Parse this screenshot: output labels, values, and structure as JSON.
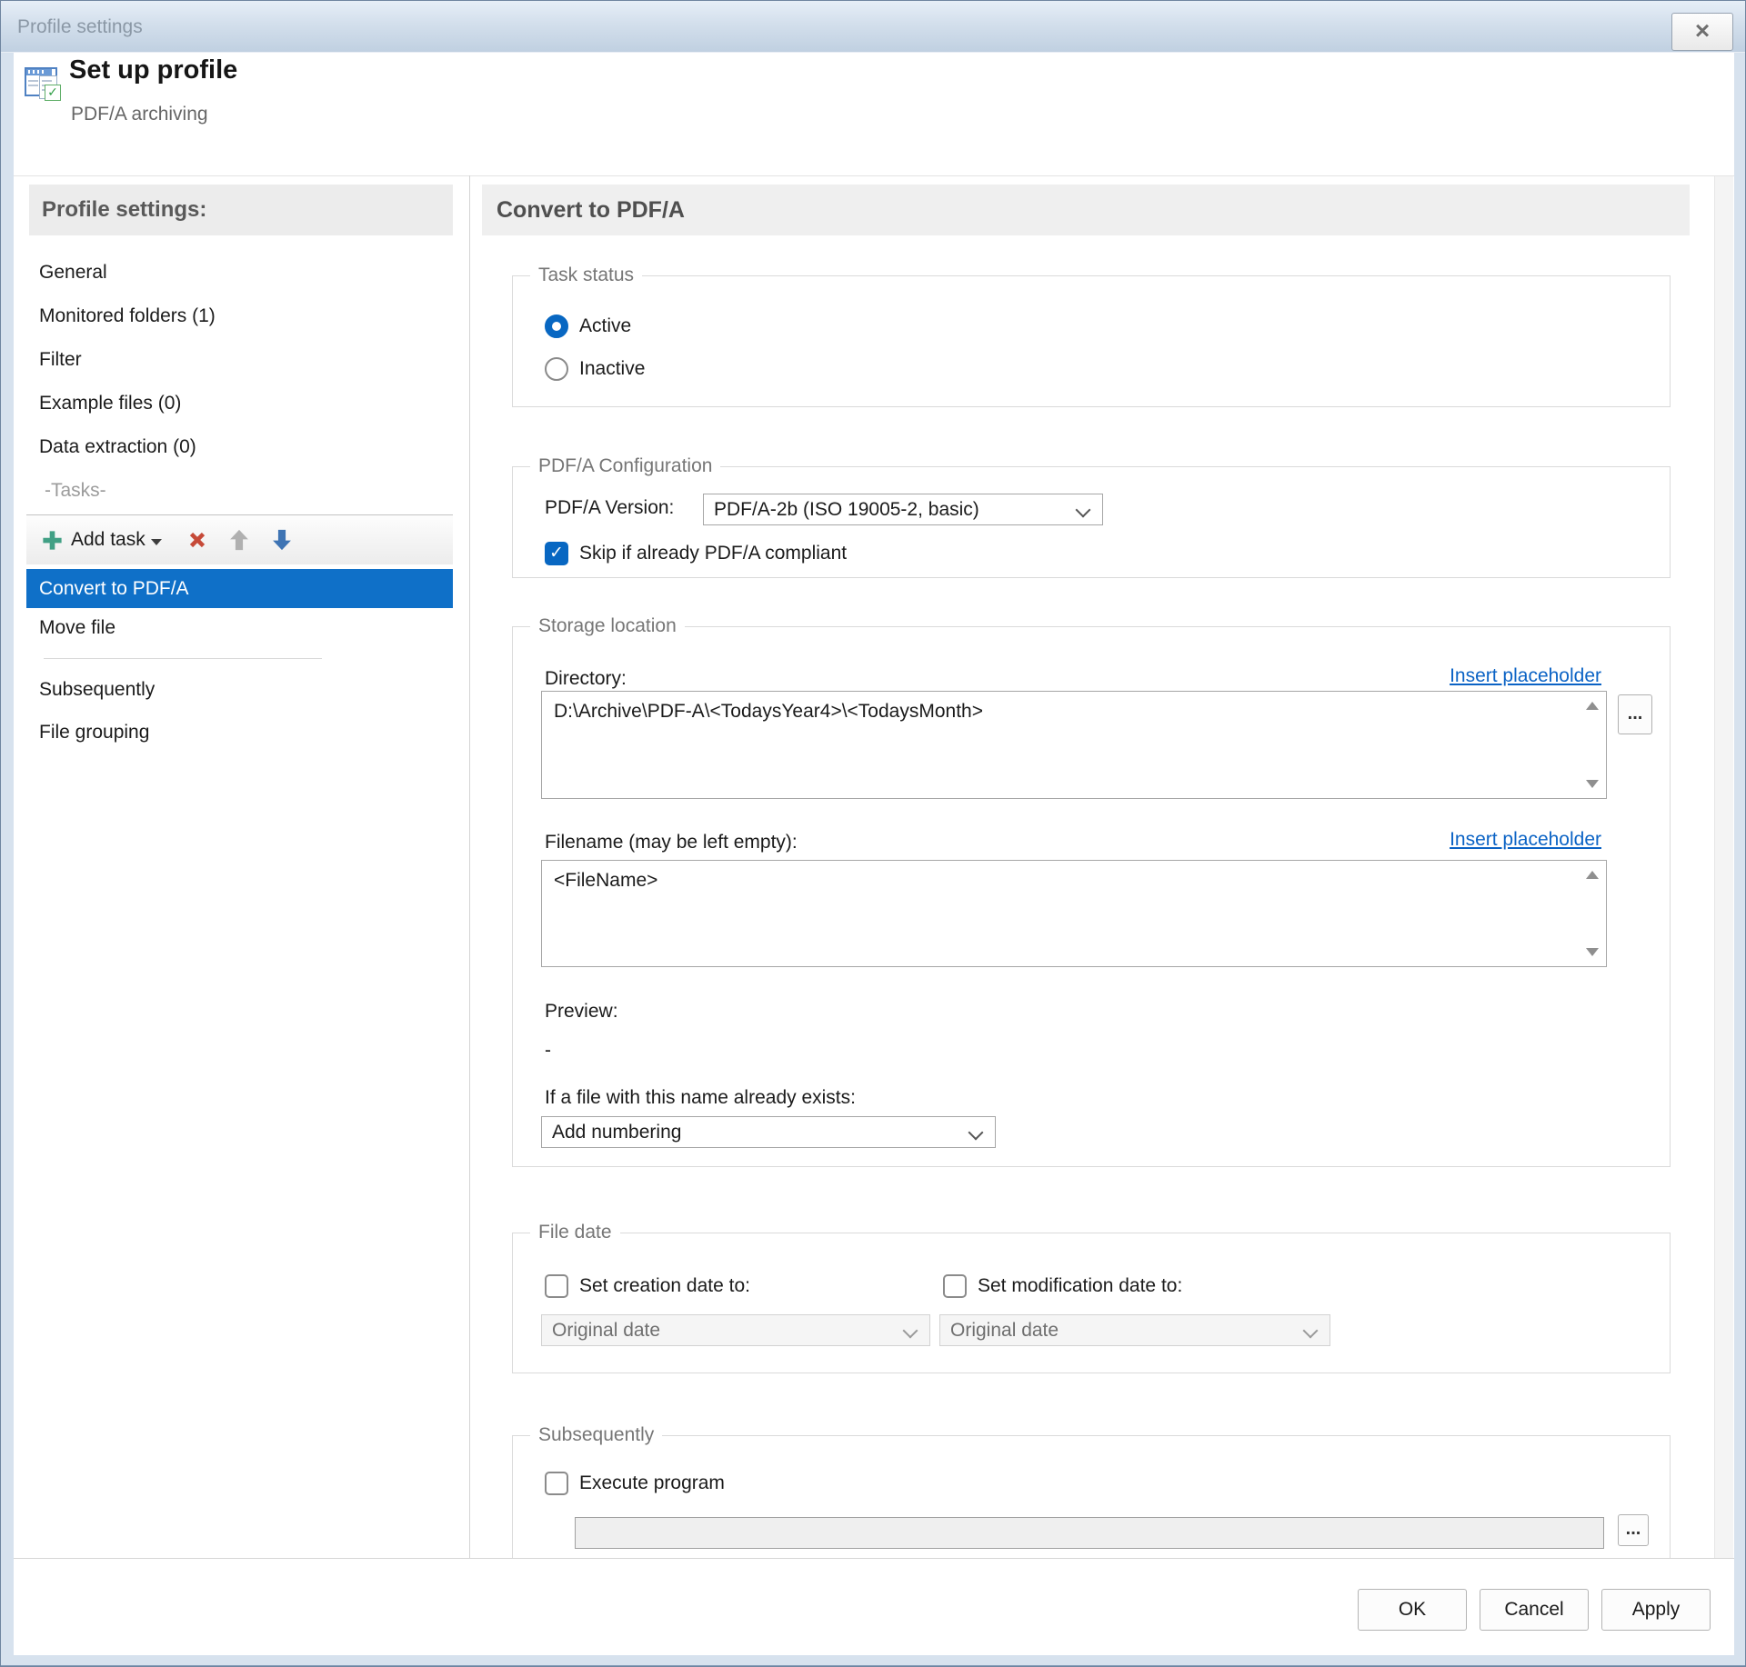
{
  "window": {
    "title": "Profile settings",
    "close_glyph": "×"
  },
  "header": {
    "title": "Set up profile",
    "subtitle": "PDF/A archiving"
  },
  "sidebar": {
    "heading": "Profile settings:",
    "items": [
      "General",
      "Monitored folders (1)",
      "Filter",
      "Example files (0)",
      "Data extraction (0)"
    ],
    "tasks_label": "-Tasks-",
    "toolbar": {
      "add_task_label": "Add task"
    },
    "tasks": [
      {
        "label": "Convert to PDF/A",
        "selected": true
      },
      {
        "label": "Move file",
        "selected": false
      }
    ],
    "bottom_items": [
      "Subsequently",
      "File grouping"
    ]
  },
  "main": {
    "title": "Convert to PDF/A",
    "task_status": {
      "legend": "Task status",
      "options": [
        {
          "label": "Active",
          "selected": true
        },
        {
          "label": "Inactive",
          "selected": false
        }
      ]
    },
    "pdfa_config": {
      "legend": "PDF/A Configuration",
      "version_label": "PDF/A Version:",
      "version_value": "PDF/A-2b (ISO 19005-2, basic)",
      "skip_label": "Skip if already PDF/A compliant",
      "skip_checked": true,
      "check_glyph": "✓"
    },
    "storage": {
      "legend": "Storage location",
      "directory_label": "Directory:",
      "insert_placeholder": "Insert placeholder",
      "directory_value": "D:\\Archive\\PDF-A\\<TodaysYear4>\\<TodaysMonth>",
      "browse_label": "...",
      "filename_label": "Filename (may be left empty):",
      "filename_value": "<FileName>",
      "preview_label": "Preview:",
      "preview_value": "-",
      "exists_label": "If a file with this name already exists:",
      "exists_value": "Add numbering"
    },
    "file_date": {
      "legend": "File date",
      "creation_label": "Set creation date to:",
      "creation_checked": false,
      "creation_value": "Original date",
      "modification_label": "Set modification date to:",
      "modification_checked": false,
      "modification_value": "Original date"
    },
    "subsequently": {
      "legend": "Subsequently",
      "execute_label": "Execute program",
      "execute_checked": false,
      "execute_value": "",
      "browse_label": "..."
    }
  },
  "footer": {
    "ok": "OK",
    "cancel": "Cancel",
    "apply": "Apply"
  },
  "colors": {
    "accent_blue": "#0f70c8",
    "control_blue": "#0867c2",
    "link_blue": "#0b63c5",
    "add_green": "#41a085",
    "delete_red": "#c64a38",
    "arrow_up_gray": "#b0b0b0",
    "arrow_down_blue": "#3e74b4"
  }
}
